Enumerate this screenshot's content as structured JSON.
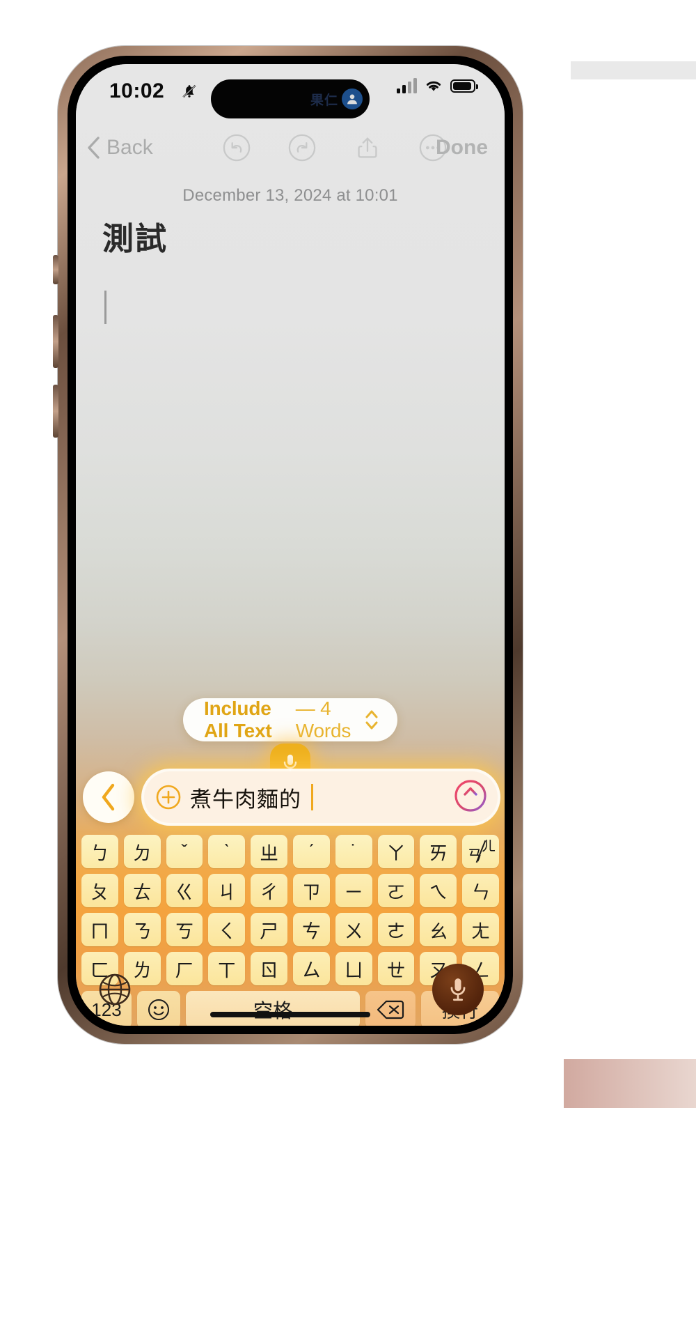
{
  "status_bar": {
    "time": "10:02",
    "silent_icon": "bell-slash-icon",
    "dynamic_island": {
      "label": "果仁",
      "avatar_icon": "person-circle-icon"
    },
    "cellular_icon": "signal-bars-icon",
    "wifi_icon": "wifi-icon",
    "battery_icon": "battery-icon"
  },
  "toolbar": {
    "back_label": "Back",
    "back_icon": "chevron-left-icon",
    "undo_icon": "undo-icon",
    "redo_icon": "redo-icon",
    "share_icon": "share-icon",
    "more_icon": "ellipsis-circle-icon",
    "done_label": "Done"
  },
  "note": {
    "date": "December 13, 2024 at 10:01",
    "title": "測試",
    "body": ""
  },
  "include_pill": {
    "strong_label": "Include All Text",
    "rest_label": "— 4 Words",
    "word_count": 4,
    "stepper_icon": "chevron-up-down-icon",
    "accent_color": "#e0a515"
  },
  "dictation": {
    "mic_bubble_icon": "microphone-icon",
    "back_icon": "chevron-left-icon",
    "add_icon": "plus-circle-icon",
    "text": "煮牛肉麵的",
    "send_icon": "arrow-up-circle-icon",
    "send_gradient": [
      "#f0486a",
      "#8b5cd6"
    ],
    "glow_color": "#ffc846"
  },
  "keyboard": {
    "type": "zhuyin-bopomofo",
    "rows": [
      [
        {
          "label": "ㄅ"
        },
        {
          "label": "ㄉ"
        },
        {
          "label": "ˇ"
        },
        {
          "label": "ˋ"
        },
        {
          "label": "ㄓ"
        },
        {
          "label": "ˊ"
        },
        {
          "label": "˙"
        },
        {
          "label": "ㄚ"
        },
        {
          "label": "ㄞ"
        },
        {
          "label": "ㄢ",
          "sup": "ㄦ",
          "dual": true
        }
      ],
      [
        {
          "label": "ㄆ"
        },
        {
          "label": "ㄊ"
        },
        {
          "label": "ㄍ"
        },
        {
          "label": "ㄐ"
        },
        {
          "label": "ㄔ"
        },
        {
          "label": "ㄗ"
        },
        {
          "label": "ㄧ"
        },
        {
          "label": "ㄛ"
        },
        {
          "label": "ㄟ"
        },
        {
          "label": "ㄣ"
        }
      ],
      [
        {
          "label": "ㄇ"
        },
        {
          "label": "ㄋ"
        },
        {
          "label": "ㄎ"
        },
        {
          "label": "ㄑ"
        },
        {
          "label": "ㄕ"
        },
        {
          "label": "ㄘ"
        },
        {
          "label": "ㄨ"
        },
        {
          "label": "ㄜ"
        },
        {
          "label": "ㄠ"
        },
        {
          "label": "ㄤ"
        }
      ],
      [
        {
          "label": "ㄈ"
        },
        {
          "label": "ㄌ"
        },
        {
          "label": "ㄏ"
        },
        {
          "label": "ㄒ"
        },
        {
          "label": "ㄖ"
        },
        {
          "label": "ㄙ"
        },
        {
          "label": "ㄩ"
        },
        {
          "label": "ㄝ"
        },
        {
          "label": "ㄡ"
        },
        {
          "label": "ㄥ"
        }
      ]
    ],
    "numeric_label": "123",
    "emoji_label": "☺",
    "space_label": "空格",
    "delete_icon": "delete-left-icon",
    "return_label": "換行",
    "globe_icon": "globe-icon",
    "dictate_icon": "microphone-icon"
  }
}
